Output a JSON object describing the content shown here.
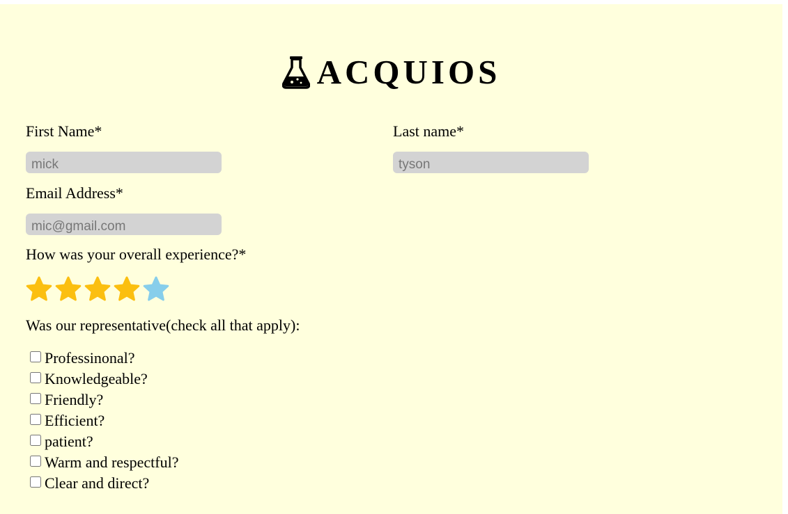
{
  "brand": {
    "title": "ACQUIOS",
    "logo_icon": "flask-icon"
  },
  "form": {
    "first_name": {
      "label": "First Name*",
      "placeholder": "mick"
    },
    "last_name": {
      "label": "Last name*",
      "placeholder": "tyson"
    },
    "email": {
      "label": "Email Address*",
      "placeholder": "mic@gmail.com"
    },
    "experience": {
      "label": "How was your overall experience?*",
      "rating": 4,
      "max": 5,
      "filled_color": "#fbbf10",
      "hover_color": "#87ceeb"
    },
    "representative": {
      "label": "Was our representative(check all that apply):",
      "options": [
        "Professinonal?",
        "Knowledgeable?",
        "Friendly?",
        "Efficient?",
        "patient?",
        "Warm and respectful?",
        "Clear and direct?"
      ]
    }
  }
}
